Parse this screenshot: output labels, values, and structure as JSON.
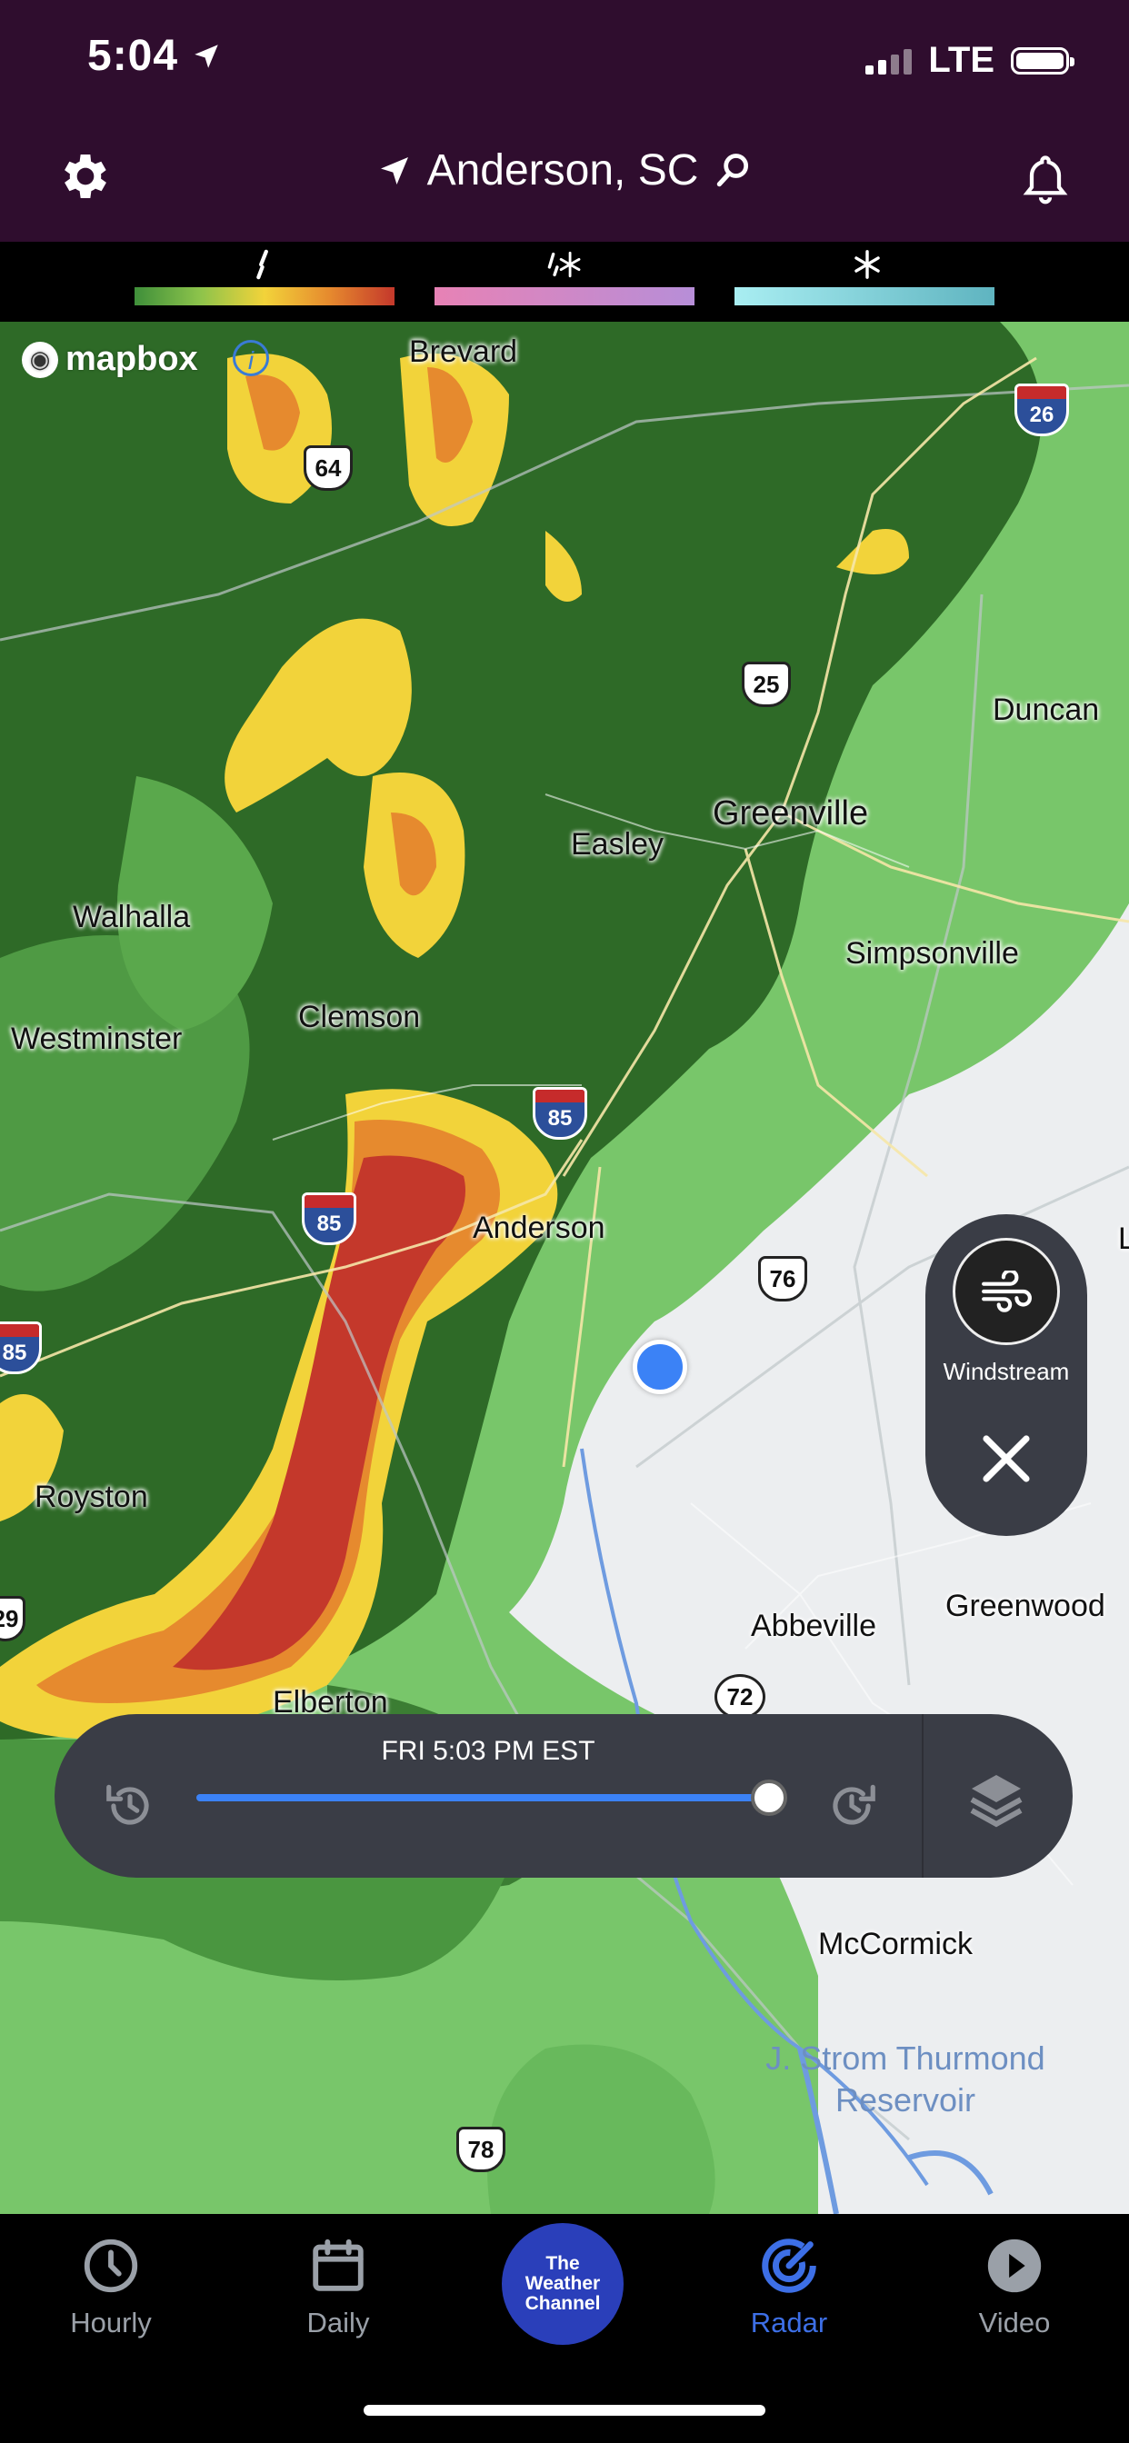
{
  "status_bar": {
    "time": "5:04",
    "network": "LTE"
  },
  "header": {
    "location": "Anderson, SC"
  },
  "map": {
    "attribution": "mapbox",
    "cities": {
      "brevard": "Brevard",
      "duncan": "Duncan",
      "easley": "Easley",
      "greenville": "Greenville",
      "walhalla": "Walhalla",
      "simpsonville": "Simpsonville",
      "westminster": "Westminster",
      "clemson": "Clemson",
      "anderson": "Anderson",
      "royston": "Royston",
      "abbeville": "Abbeville",
      "greenwood": "Greenwood",
      "elberton": "Elberton",
      "mccormick": "McCormick",
      "edge_l": "L",
      "reservoir": "J. Strom Thurmond Reservoir"
    },
    "shields": {
      "us64": "64",
      "us25": "25",
      "us76": "76",
      "sc72": "72",
      "us78": "78",
      "i26": "26",
      "i85a": "85",
      "i85b": "85",
      "i85c": "85",
      "edge29": "29"
    }
  },
  "windstream": {
    "label": "Windstream"
  },
  "timeline": {
    "timestamp": "FRI 5:03 PM EST",
    "progress_percent": 100
  },
  "tabs": {
    "hourly": "Hourly",
    "daily": "Daily",
    "twc": "The Weather Channel",
    "radar": "Radar",
    "video": "Video",
    "active": "Radar"
  },
  "colors": {
    "header_bg": "#2f0d2e",
    "accent": "#3d6fe6",
    "timeline_bg": "#3a3d46",
    "radar_green": "#2f6b28",
    "radar_yellow": "#f2d33a",
    "radar_red": "#c4382b"
  }
}
